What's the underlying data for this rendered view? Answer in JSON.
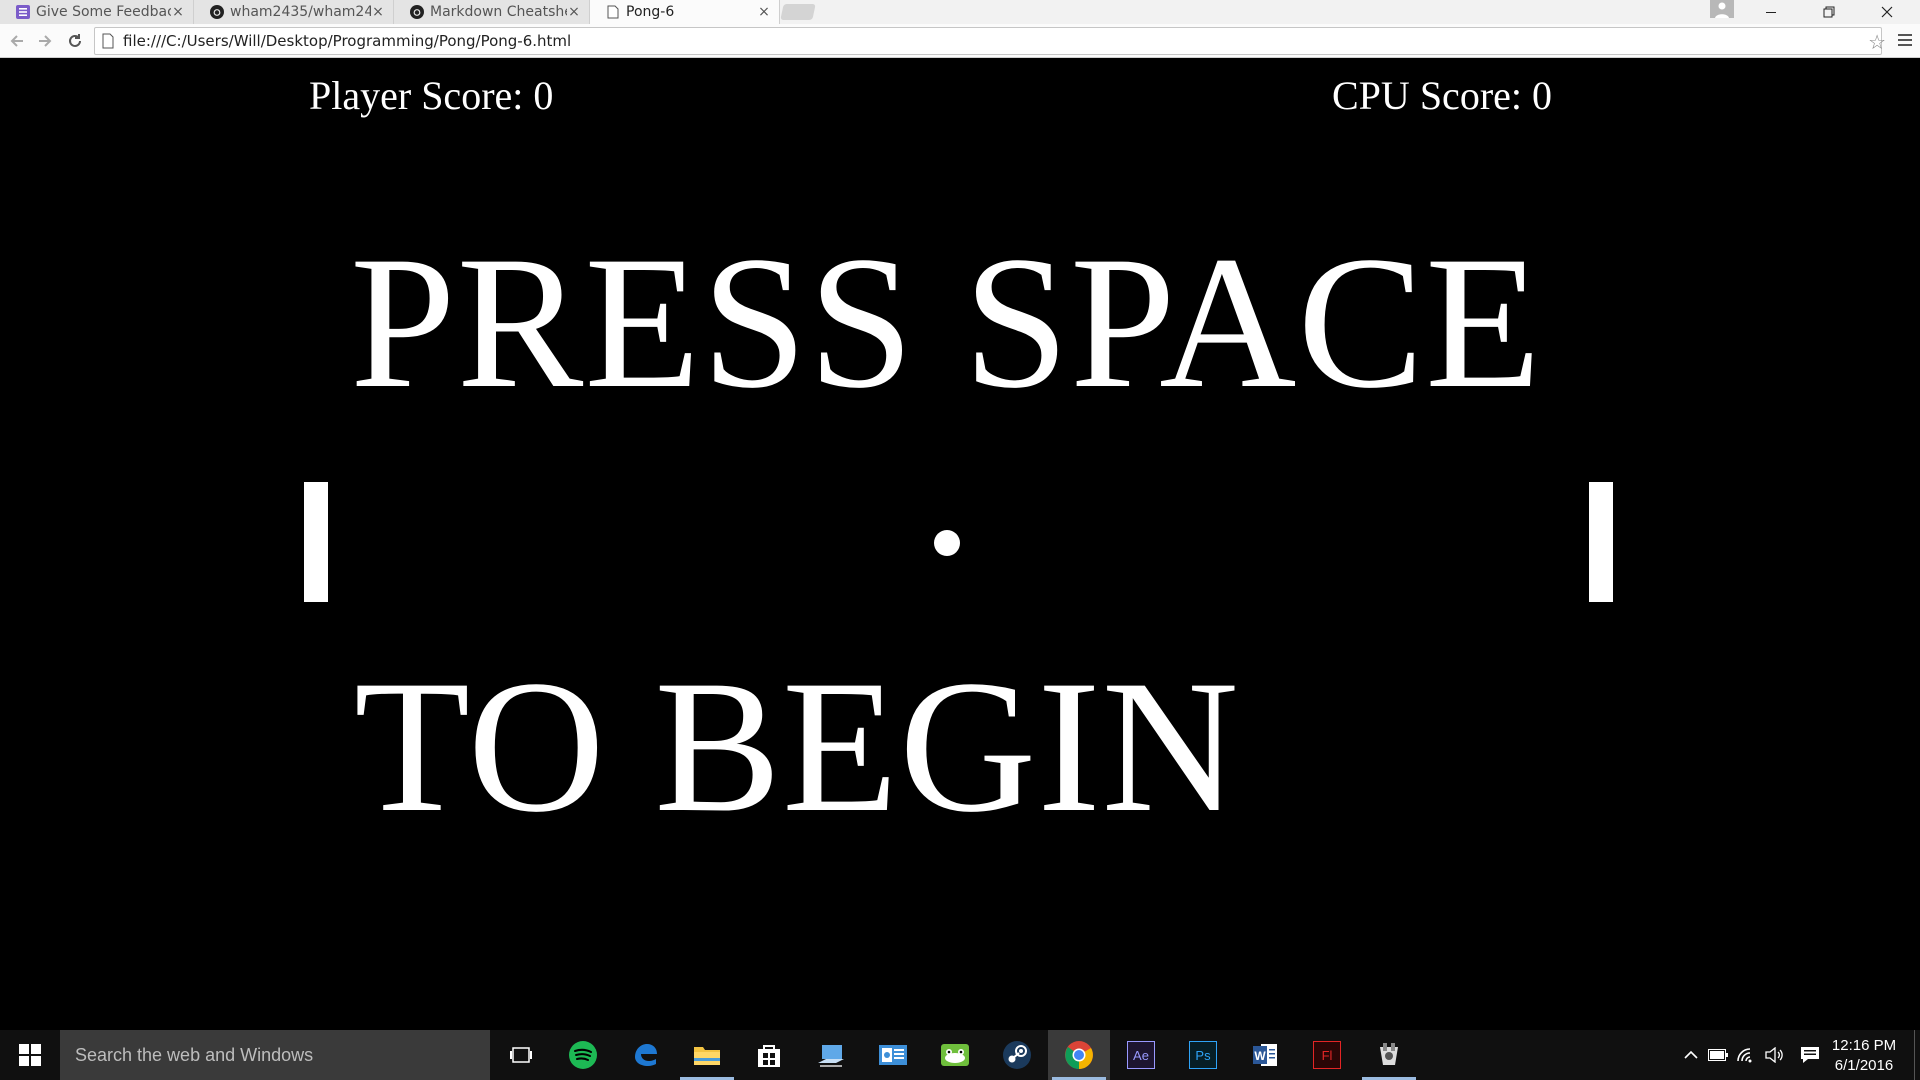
{
  "browser": {
    "tabs": [
      {
        "label": "Give Some Feedback",
        "icon": "form-icon"
      },
      {
        "label": "wham2435/wham24",
        "icon": "github-icon"
      },
      {
        "label": "Markdown Cheatshe",
        "icon": "github-icon"
      },
      {
        "label": "Pong-6",
        "icon": "page-icon",
        "active": true
      }
    ],
    "close_glyph": "×",
    "url": "file:///C:/Users/Will/Desktop/Programming/Pong/Pong-6.html"
  },
  "game": {
    "player_score": "Player Score: 0",
    "cpu_score": "CPU Score: 0",
    "message_line1": "PRESS SPACE",
    "message_line2": "TO BEGIN"
  },
  "taskbar": {
    "search_placeholder": "Search the web and Windows",
    "apps": [
      "task-view",
      "spotify",
      "edge",
      "file-explorer",
      "store",
      "remote-desktop",
      "outlook",
      "frog-app",
      "steam",
      "chrome",
      "after-effects",
      "photoshop",
      "word",
      "flash",
      "game-app"
    ],
    "app_labels": {
      "after_effects": "Ae",
      "photoshop": "Ps",
      "word": "W",
      "flash": "Fl"
    },
    "time": "12:16 PM",
    "date": "6/1/2016"
  },
  "colors": {
    "game_bg": "#000000",
    "game_fg": "#ffffff",
    "taskbar_bg": "#101010",
    "spotify": "#1db954",
    "edge": "#1e78d2",
    "photoshop": "#2fa3f7",
    "after_effects": "#9999ff",
    "flash": "#e32525"
  }
}
